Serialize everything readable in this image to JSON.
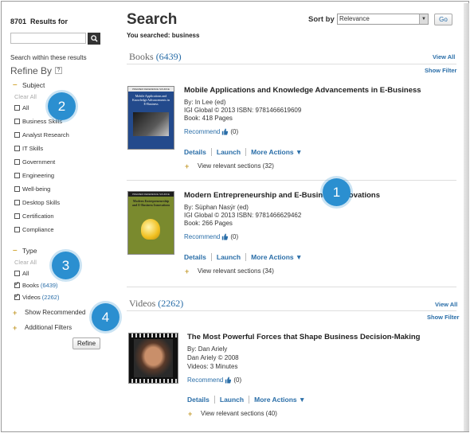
{
  "sidebar": {
    "results_count": "8701",
    "results_for": "Results for",
    "search_value": "",
    "within_label": "Search within these results",
    "refine_title": "Refine By",
    "help_label": "?",
    "subject": {
      "heading": "Subject",
      "clear_all": "Clear All",
      "items": [
        "All",
        "Business Skills",
        "Analyst Research",
        "IT Skills",
        "Government",
        "Engineering",
        "Well-being",
        "Desktop Skills",
        "Certification",
        "Compliance"
      ]
    },
    "type": {
      "heading": "Type",
      "clear_all": "Clear All",
      "items": [
        {
          "label": "All",
          "count": "",
          "checked": false
        },
        {
          "label": "Books",
          "count": "(6439)",
          "checked": true
        },
        {
          "label": "Videos",
          "count": "(2262)",
          "checked": true
        }
      ]
    },
    "show_recommended": "Show Recommended",
    "additional_filters": "Additional Filters",
    "refine_button": "Refine"
  },
  "badges": [
    "1",
    "2",
    "3",
    "4"
  ],
  "main": {
    "title": "Search",
    "searched_prefix": "You searched: business",
    "sort_label": "Sort by",
    "sort_value": "Relevance",
    "go_label": "Go",
    "books": {
      "label": "Books",
      "count": "(6439)",
      "view_all": "View All",
      "show_filter": "Show Filter",
      "items": [
        {
          "title": "Mobile Applications and Knowledge Advancements in E-Business",
          "by": "By: In Lee (ed)",
          "publisher": "IGI Global © 2013   ISBN: 9781466619609",
          "pages": "Book: 418 Pages",
          "recommend": "Recommend",
          "rec_count": "(0)",
          "details": "Details",
          "launch": "Launch",
          "more": "More Actions ▼",
          "sections": "View relevant sections (32)",
          "cover_title": "Mobile Applications and Knowledge Advancements in E-Business",
          "cover_header": "PREMIER REFERENCE SOURCE"
        },
        {
          "title": "Modern Entrepreneurship and E-Business Innovations",
          "by": "By: Süphan Nasýr (ed)",
          "publisher": "IGI Global © 2013   ISBN: 9781466629462",
          "pages": "Book: 266 Pages",
          "recommend": "Recommend",
          "rec_count": "(0)",
          "details": "Details",
          "launch": "Launch",
          "more": "More Actions ▼",
          "sections": "View relevant sections (34)",
          "cover_title": "Modern Entrepreneurship and E-Business Innovations",
          "cover_header": "PREMIER REFERENCE SOURCE"
        }
      ]
    },
    "videos": {
      "label": "Videos",
      "count": "(2262)",
      "view_all": "View All",
      "show_filter": "Show Filter",
      "items": [
        {
          "title": "The Most Powerful Forces that Shape Business Decision-Making",
          "by": "By: Dan Ariely",
          "publisher": "Dan Ariely © 2008",
          "duration": "Videos: 3 Minutes",
          "recommend": "Recommend",
          "rec_count": "(0)",
          "details": "Details",
          "launch": "Launch",
          "more": "More Actions ▼",
          "sections": "View relevant sections (40)"
        }
      ]
    }
  },
  "colors": {
    "link": "#2a6ea8",
    "badge": "#2b8fd0",
    "plus": "#c8a23c"
  }
}
